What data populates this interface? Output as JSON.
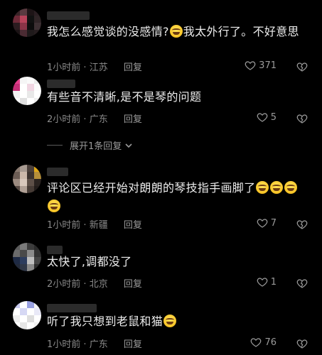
{
  "comments": [
    {
      "text_before": "我怎么感觉谈的没感情?",
      "text_after": "我太外行了。不好意思",
      "time": "1小时前",
      "location": "江苏",
      "reply": "回复",
      "likes": "371"
    },
    {
      "text": "有些音不清晰,是不是琴的问题",
      "time": "2小时前",
      "location": "广东",
      "reply": "回复",
      "likes": "5",
      "expand": "展开1条回复"
    },
    {
      "text": "评论区已经开始对朗朗的琴技指手画脚了",
      "time": "1小时前",
      "location": "新疆",
      "reply": "回复",
      "likes": "7"
    },
    {
      "text": "太快了,调都没了",
      "time": "2小时前",
      "location": "北京",
      "reply": "回复",
      "likes": "1"
    },
    {
      "text": "听了我只想到老鼠和猫",
      "time": "1小时前",
      "location": "广东",
      "reply": "回复",
      "likes": "76"
    }
  ],
  "icons": {
    "like": "heart-outline-icon",
    "dislike": "broken-heart-icon",
    "expand": "chevron-down-icon",
    "emoji": "laughing-tears-emoji"
  },
  "colors": {
    "background": "#000000",
    "text": "#ececec",
    "meta": "#8a8a8a"
  }
}
